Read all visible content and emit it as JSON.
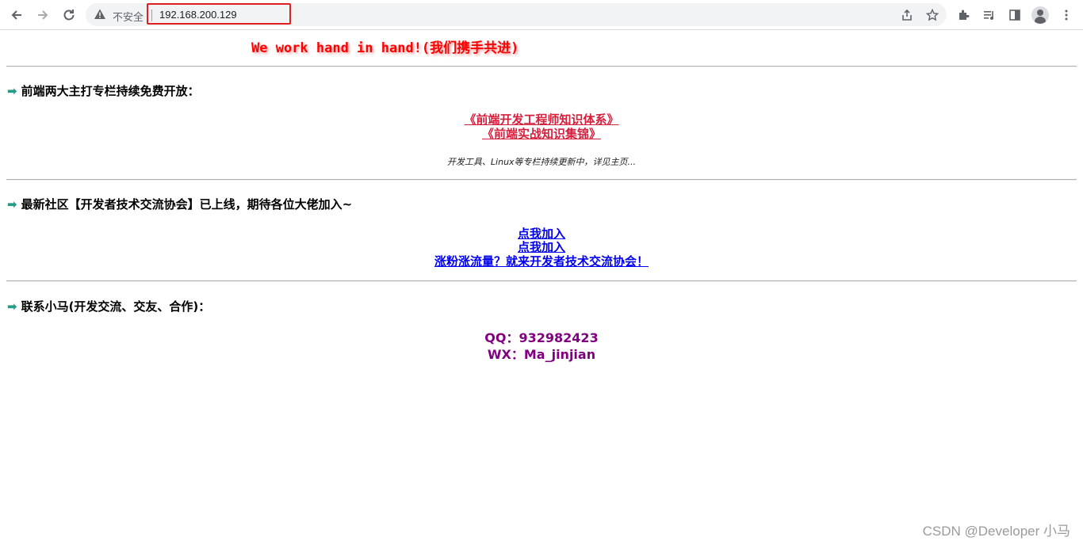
{
  "browser": {
    "security_label": "不安全",
    "url": "192.168.200.129",
    "icons": {
      "back": "arrow-left-icon",
      "forward": "arrow-right-icon",
      "reload": "reload-icon",
      "warning": "warning-triangle-icon",
      "share": "share-icon",
      "bookmark": "star-icon",
      "extensions": "puzzle-icon",
      "media": "media-playlist-icon",
      "side_panel": "side-panel-icon",
      "profile": "avatar-icon",
      "menu": "kebab-menu-icon"
    }
  },
  "page": {
    "slogan": "We work hand in hand!(我们携手共进)",
    "section1": {
      "heading": "前端两大主打专栏持续免费开放：",
      "links": [
        "《前端开发工程师知识体系》",
        "《前端实战知识集锦》"
      ],
      "note": "开发工具、Linux等专栏持续更新中，详见主页..."
    },
    "section2": {
      "heading": "最新社区【开发者技术交流协会】已上线，期待各位大佬加入~",
      "links": [
        "点我加入",
        "点我加入",
        "涨粉涨流量？就来开发者技术交流协会！"
      ]
    },
    "section3": {
      "heading": "联系小马(开发交流、交友、合作)：",
      "qq": "QQ：932982423",
      "wx": "WX：Ma_jinjian"
    },
    "watermark": "CSDN @Developer 小马"
  },
  "colors": {
    "slogan": "#ff0000",
    "red_link": "#d61f3d",
    "blue_link": "#0000ee",
    "contact": "#800080",
    "arrow": "#2a9a88",
    "url_highlight_border": "#e02020"
  }
}
